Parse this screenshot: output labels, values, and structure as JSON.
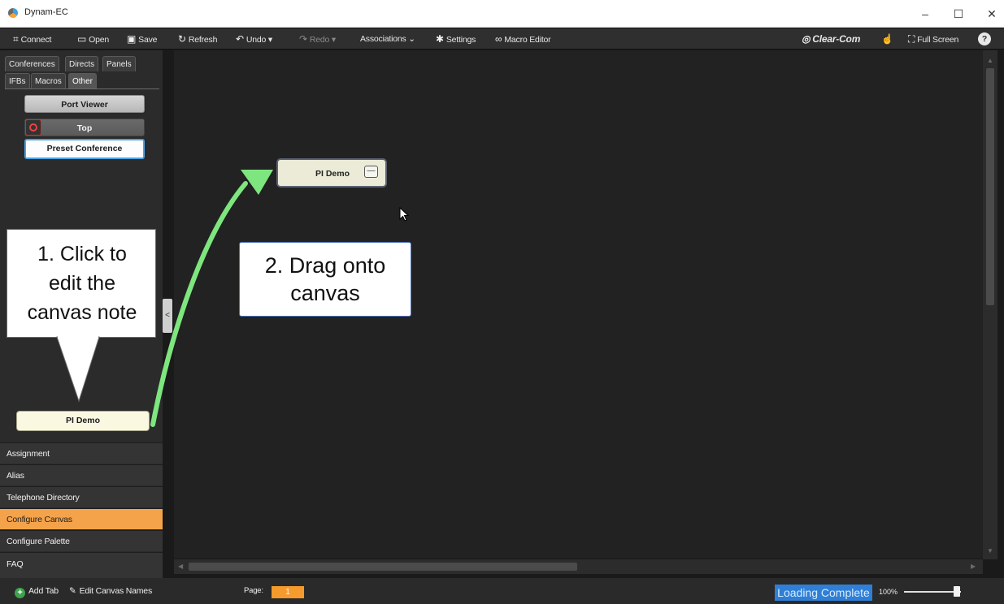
{
  "window": {
    "title": "Dynam-EC",
    "minimize": "–",
    "maximize": "☐",
    "close": "✕"
  },
  "toolbar": {
    "connect": "Connect",
    "open": "Open",
    "save": "Save",
    "refresh": "Refresh",
    "undo": "Undo",
    "redo": "Redo",
    "associations": "Associations",
    "settings": "Settings",
    "macro_editor": "Macro Editor",
    "brand": "Clear-Com",
    "full_screen": "Full Screen",
    "help": "?"
  },
  "sidebar": {
    "tabs_row1": [
      "Conferences",
      "Directs",
      "Panels"
    ],
    "tabs_row2": [
      "IFBs",
      "Macros",
      "Other"
    ],
    "active_tab": "Other",
    "palette_items": [
      "Port Viewer",
      "Top",
      "Preset Conference"
    ],
    "note_item": "PI Demo",
    "menu_items": [
      "Assignment",
      "Alias",
      "Telephone Directory",
      "Configure Canvas",
      "Configure Palette",
      "FAQ"
    ],
    "active_menu": "Configure Canvas",
    "collapse": "<"
  },
  "canvas": {
    "note_label": "PI Demo",
    "note_button": "—"
  },
  "callouts": {
    "step1": [
      "1. Click to",
      "edit the",
      "canvas note"
    ],
    "step2": [
      "2. Drag onto",
      "canvas"
    ]
  },
  "status": {
    "add_tab": "Add Tab",
    "edit_canvas_names": "Edit Canvas Names",
    "page_label": "Page:",
    "page_value": "1",
    "loading": "Loading Complete",
    "zoom": "100%",
    "zoom_level": 1.0
  },
  "colors": {
    "accent_orange": "#f5a34a",
    "arrow_green": "#7ee67e",
    "loading_blue": "#2f7fd6"
  }
}
